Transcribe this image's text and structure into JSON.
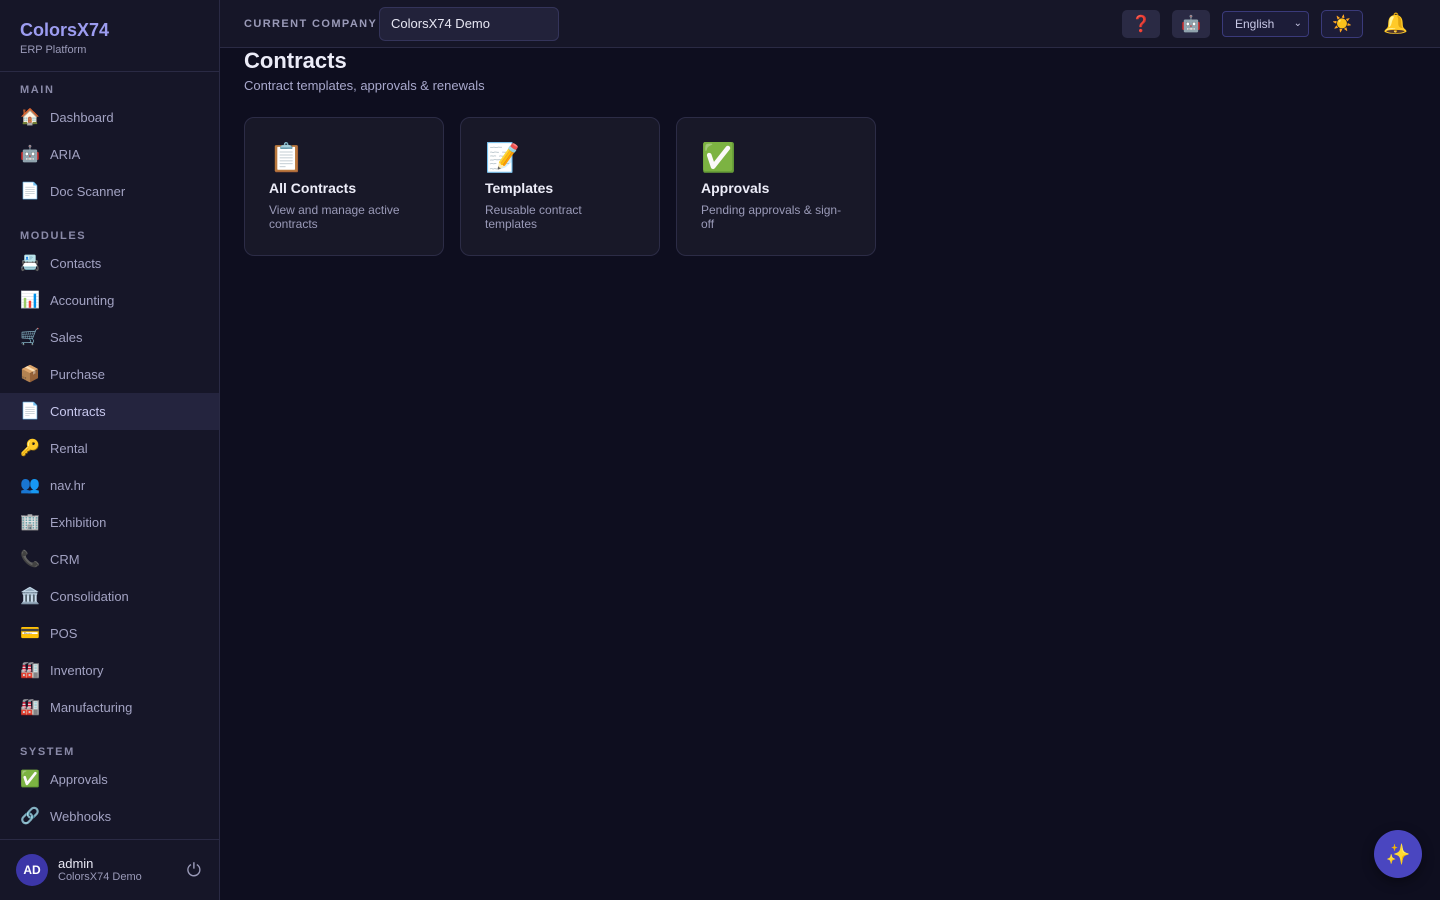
{
  "brand": {
    "title": "ColorsX74",
    "subtitle": "ERP Platform"
  },
  "sidebar": {
    "sections": [
      {
        "label": "MAIN"
      },
      {
        "label": "MODULES"
      },
      {
        "label": "SYSTEM"
      }
    ],
    "items": [
      {
        "icon": "🏠",
        "icon_name": "home-icon",
        "label": "Dashboard"
      },
      {
        "icon": "🤖",
        "icon_name": "robot-icon",
        "label": "ARIA"
      },
      {
        "icon": "📄",
        "icon_name": "document-icon",
        "label": "Doc Scanner"
      },
      {
        "icon": "📇",
        "icon_name": "card-index-icon",
        "label": "Contacts"
      },
      {
        "icon": "📊",
        "icon_name": "bar-chart-icon",
        "label": "Accounting"
      },
      {
        "icon": "🛒",
        "icon_name": "shopping-cart-icon",
        "label": "Sales"
      },
      {
        "icon": "📦",
        "icon_name": "package-icon",
        "label": "Purchase"
      },
      {
        "icon": "📄",
        "icon_name": "document-icon",
        "label": "Contracts",
        "active": true
      },
      {
        "icon": "🔑",
        "icon_name": "key-icon",
        "label": "Rental"
      },
      {
        "icon": "👥",
        "icon_name": "people-icon",
        "label": "nav.hr"
      },
      {
        "icon": "🏢",
        "icon_name": "office-building-icon",
        "label": "Exhibition"
      },
      {
        "icon": "📞",
        "icon_name": "phone-icon",
        "label": "CRM"
      },
      {
        "icon": "🏛️",
        "icon_name": "classical-building-icon",
        "label": "Consolidation"
      },
      {
        "icon": "💳",
        "icon_name": "credit-card-icon",
        "label": "POS"
      },
      {
        "icon": "🏭",
        "icon_name": "factory-icon",
        "label": "Inventory"
      },
      {
        "icon": "🏭",
        "icon_name": "factory-icon",
        "label": "Manufacturing"
      },
      {
        "icon": "✅",
        "icon_name": "check-mark-icon",
        "label": "Approvals"
      },
      {
        "icon": "🔗",
        "icon_name": "link-icon",
        "label": "Webhooks"
      }
    ]
  },
  "user": {
    "initials": "AD",
    "name": "admin",
    "company": "ColorsX74 Demo",
    "logout_icon": "⏻"
  },
  "topbar": {
    "company_label": "CURRENT COMPANY",
    "company_value": "ColorsX74 Demo",
    "help_icon": "❓",
    "bot_icon": "🤖",
    "language": "English",
    "language_chevron": "⌄",
    "theme_icon": "☀️",
    "bell_icon": "🔔"
  },
  "page": {
    "title": "Contracts",
    "subtitle": "Contract templates, approvals & renewals"
  },
  "cards": [
    {
      "icon": "📋",
      "icon_name": "clipboard-icon",
      "title": "All Contracts",
      "desc": "View and manage active contracts"
    },
    {
      "icon": "📝",
      "icon_name": "memo-icon",
      "title": "Templates",
      "desc": "Reusable contract templates"
    },
    {
      "icon": "✅",
      "icon_name": "check-mark-icon",
      "title": "Approvals",
      "desc": "Pending approvals & sign-off"
    }
  ],
  "fab": {
    "icon": "✨"
  },
  "colors": {
    "accent": "#4a46c0",
    "brand": "#9c9cf0",
    "background": "#0e0e1f",
    "sidebar": "#161628"
  }
}
